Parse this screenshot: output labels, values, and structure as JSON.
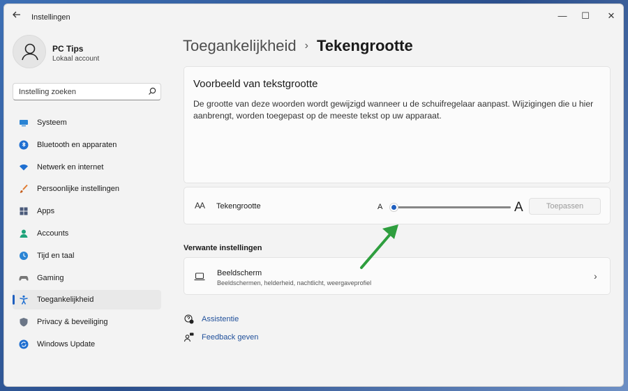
{
  "app": {
    "title": "Instellingen"
  },
  "window_controls": {
    "minimize": "—",
    "maximize": "☐",
    "close": "✕"
  },
  "profile": {
    "name": "PC Tips",
    "account_type": "Lokaal account"
  },
  "search": {
    "placeholder": "Instelling zoeken"
  },
  "sidebar": {
    "items": [
      {
        "label": "Systeem",
        "icon": "monitor-icon",
        "active": false
      },
      {
        "label": "Bluetooth en apparaten",
        "icon": "bluetooth-icon",
        "active": false
      },
      {
        "label": "Netwerk en internet",
        "icon": "wifi-icon",
        "active": false
      },
      {
        "label": "Persoonlijke instellingen",
        "icon": "brush-icon",
        "active": false
      },
      {
        "label": "Apps",
        "icon": "apps-icon",
        "active": false
      },
      {
        "label": "Accounts",
        "icon": "person-icon",
        "active": false
      },
      {
        "label": "Tijd en taal",
        "icon": "clock-globe-icon",
        "active": false
      },
      {
        "label": "Gaming",
        "icon": "gamepad-icon",
        "active": false
      },
      {
        "label": "Toegankelijkheid",
        "icon": "accessibility-icon",
        "active": true
      },
      {
        "label": "Privacy & beveiliging",
        "icon": "shield-icon",
        "active": false
      },
      {
        "label": "Windows Update",
        "icon": "update-icon",
        "active": false
      }
    ]
  },
  "breadcrumb": {
    "parent": "Toegankelijkheid",
    "separator": "›",
    "current": "Tekengrootte"
  },
  "preview": {
    "title": "Voorbeeld van tekstgrootte",
    "text": "De grootte van deze woorden wordt gewijzigd wanneer u de schuifregelaar aanpast. Wijzigingen die u hier aanbrengt, worden toegepast op de meeste tekst op uw apparaat."
  },
  "text_size": {
    "icon_text": "AA",
    "label": "Tekengrootte",
    "slider_min_label": "A",
    "slider_max_label": "A",
    "slider_value_fraction": 0,
    "apply_label": "Toepassen"
  },
  "related": {
    "heading": "Verwante instellingen",
    "display": {
      "title": "Beeldscherm",
      "subtitle": "Beeldschermen, helderheid, nachtlicht, weergaveprofiel"
    }
  },
  "links": {
    "help": "Assistentie",
    "feedback": "Feedback geven"
  },
  "colors": {
    "accent": "#1f5fbf",
    "annotation_arrow": "#2e9e3e"
  }
}
